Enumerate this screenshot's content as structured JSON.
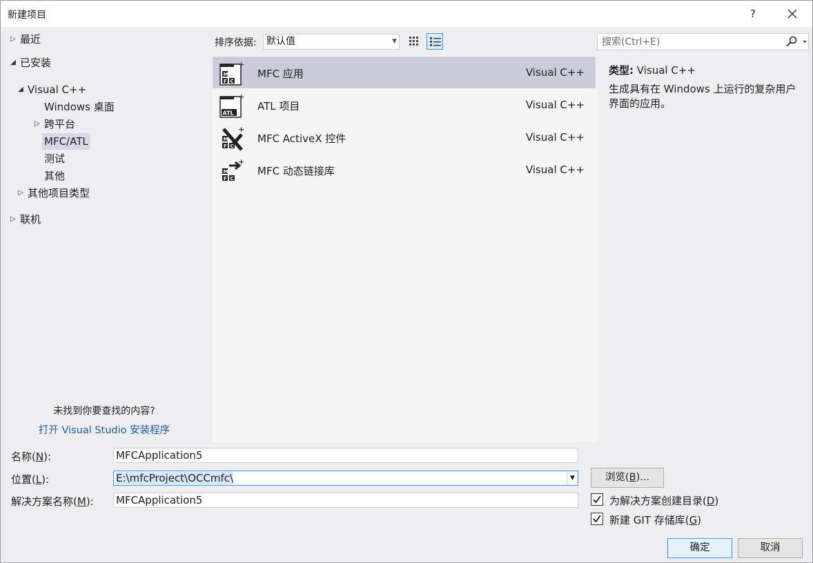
{
  "window": {
    "title": "新建项目",
    "help_label": "?"
  },
  "tree": {
    "recent": "最近",
    "installed": "已安装",
    "visual_cpp": "Visual C++",
    "windows_desktop": "Windows 桌面",
    "cross_platform": "跨平台",
    "mfc_atl": "MFC/ATL",
    "test": "测试",
    "other": "其他",
    "other_project_types": "其他项目类型",
    "online": "联机"
  },
  "left_footer": {
    "not_found": "未找到你要查找的内容?",
    "installer_link": "打开 Visual Studio 安装程序"
  },
  "sortbar": {
    "label": "排序依据:",
    "value": "默认值",
    "views": [
      "grid-view-icon",
      "list-view-icon"
    ],
    "active_view": "list"
  },
  "templates": [
    {
      "name": "MFC 应用",
      "lang": "Visual C++",
      "icon": "mfc-app-icon",
      "selected": true
    },
    {
      "name": "ATL 项目",
      "lang": "Visual C++",
      "icon": "atl-project-icon",
      "selected": false
    },
    {
      "name": "MFC ActiveX 控件",
      "lang": "Visual C++",
      "icon": "mfc-activex-icon",
      "selected": false
    },
    {
      "name": "MFC 动态链接库",
      "lang": "Visual C++",
      "icon": "mfc-dll-icon",
      "selected": false
    }
  ],
  "search": {
    "placeholder": "搜索(Ctrl+E)",
    "value": ""
  },
  "description": {
    "type_label": "类型:",
    "type_value": "Visual C++",
    "text": "生成具有在 Windows 上运行的复杂用户界面的应用。"
  },
  "form": {
    "name_label": "名称(",
    "name_key": "N",
    "name_label_end": "):",
    "name_value": "MFCApplication5",
    "location_label": "位置(",
    "location_key": "L",
    "location_label_end": "):",
    "location_value": "E:\\mfcProject\\OCCmfc\\",
    "solution_label": "解决方案名称(",
    "solution_key": "M",
    "solution_label_end": "):",
    "solution_value": "MFCApplication5",
    "browse_label": "浏览(",
    "browse_key": "B",
    "browse_label_end": ")...",
    "create_dir_label": "为解决方案创建目录(",
    "create_dir_key": "D",
    "create_dir_label_end": ")",
    "create_dir_checked": true,
    "git_label": "新建 GIT 存储库(",
    "git_key": "G",
    "git_label_end": ")",
    "git_checked": true
  },
  "buttons": {
    "ok": "确定",
    "cancel": "取消"
  },
  "colors": {
    "accent": "#3399ff",
    "link": "#1a5ea8",
    "icon_purple": "#68217a",
    "selected_row": "#cbcbd9"
  }
}
